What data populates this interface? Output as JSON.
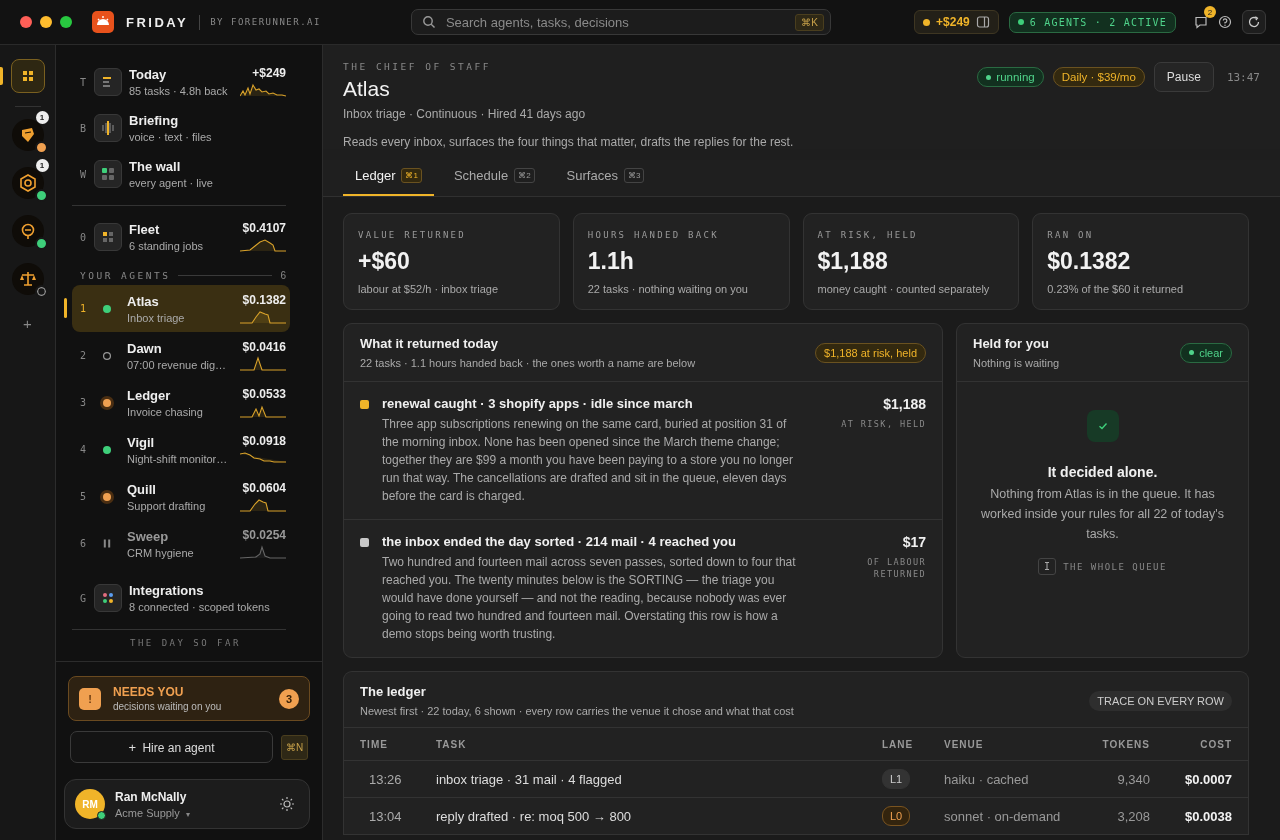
{
  "topbar": {
    "brand": "FRIDAY",
    "byline": "BY FORERUNNER.AI",
    "search": {
      "placeholder": "Search agents, tasks, decisions",
      "shortcut": "⌘K"
    },
    "earnings": "+$249",
    "agents_pill": "6 AGENTS · 2 ACTIVE",
    "messages_badge": "2"
  },
  "rail": {
    "home_selected": true,
    "agents": [
      {
        "badge": "1",
        "kind": "attention"
      },
      {
        "badge": "1",
        "kind": "running"
      },
      {
        "kind": "running"
      },
      {
        "kind": "idle"
      }
    ],
    "add": "+"
  },
  "sidebar": {
    "nav": [
      {
        "key": "T",
        "title": "Today",
        "subtitle": "85 tasks · 4.8h back",
        "value": "+$249"
      },
      {
        "key": "B",
        "title": "Briefing",
        "subtitle": "voice · text · files"
      },
      {
        "key": "W",
        "title": "The wall",
        "subtitle": "every agent · live"
      }
    ],
    "fleet": {
      "key": "0",
      "title": "Fleet",
      "subtitle": "6 standing jobs",
      "value": "$0.4107"
    },
    "section_label": "YOUR AGENTS",
    "section_count": "6",
    "agents": [
      {
        "key": "1",
        "name": "Atlas",
        "role": "Inbox triage",
        "cost": "$0.1382",
        "kind": "running",
        "selected": true
      },
      {
        "key": "2",
        "name": "Dawn",
        "role": "07:00 revenue dig…",
        "cost": "$0.0416",
        "kind": "idle",
        "selected": false
      },
      {
        "key": "3",
        "name": "Ledger",
        "role": "Invoice chasing",
        "cost": "$0.0533",
        "kind": "attention",
        "selected": false
      },
      {
        "key": "4",
        "name": "Vigil",
        "role": "Night-shift monitor…",
        "cost": "$0.0918",
        "kind": "running",
        "selected": false
      },
      {
        "key": "5",
        "name": "Quill",
        "role": "Support drafting",
        "cost": "$0.0604",
        "kind": "attention",
        "selected": false
      },
      {
        "key": "6",
        "name": "Sweep",
        "role": "CRM hygiene",
        "cost": "$0.0254",
        "kind": "paused",
        "selected": false
      }
    ],
    "integrations": {
      "key": "G",
      "title": "Integrations",
      "subtitle": "8 connected · scoped tokens"
    },
    "footer_label": "THE DAY SO FAR",
    "needs_you": {
      "icon": "!",
      "title": "NEEDS YOU",
      "subtitle": "decisions waiting on you",
      "count": "3"
    },
    "hire": {
      "icon": "+",
      "label": "Hire an agent",
      "shortcut": "⌘N"
    },
    "user": {
      "initials": "RM",
      "name": "Ran McNally",
      "org": "Acme Supply",
      "caret": "▾",
      "online": true
    }
  },
  "agent": {
    "eyebrow": "THE CHIEF OF STAFF",
    "name": "Atlas",
    "meta": "Inbox triage · Continuous · Hired 41 days ago",
    "description": "Reads every inbox, surfaces the four things that matter, drafts the replies for the rest.",
    "status": "running",
    "budget": "Daily · $39/mo",
    "action": "Pause",
    "time": "13:47"
  },
  "tabs": [
    {
      "label": "Ledger",
      "shortcut": "⌘1",
      "selected": true
    },
    {
      "label": "Schedule",
      "shortcut": "⌘2",
      "selected": false
    },
    {
      "label": "Surfaces",
      "shortcut": "⌘3",
      "selected": false
    }
  ],
  "stats": [
    {
      "label": "VALUE RETURNED",
      "value": "+$60",
      "note": "labour at $52/h · inbox triage"
    },
    {
      "label": "HOURS HANDED BACK",
      "value": "1.1h",
      "note": "22 tasks · nothing waiting on you"
    },
    {
      "label": "AT RISK, HELD",
      "value": "$1,188",
      "note": "money caught · counted separately"
    },
    {
      "label": "RAN ON",
      "value": "$0.1382",
      "note": "0.23% of the $60 it returned"
    }
  ],
  "returned": {
    "title": "What it returned today",
    "subtitle": "22 tasks · 1.1 hours handed back · the ones worth a name are below",
    "badge": "$1,188 at risk, held",
    "items": [
      {
        "title": "renewal caught · 3 shopify apps · idle since march",
        "body": "Three app subscriptions renewing on the same card, buried at position 31 of the morning inbox. None has been opened since the March theme change; together they are $99 a month you have been paying to a store you no longer run that way. The cancellations are drafted and sit in the queue, eleven days before the card is charged.",
        "amount": "$1,188",
        "amount_label": "AT RISK, HELD",
        "color": "#f0b429"
      },
      {
        "title": "the inbox ended the day sorted · 214 mail · 4 reached you",
        "body": "Two hundred and fourteen mail across seven passes, sorted down to four that reached you. The twenty minutes below is the SORTING — the triage you would have done yourself — and not the reading, because nobody was ever going to read two hundred and fourteen mail. Overstating this row is how a demo stops being worth trusting.",
        "amount": "$17",
        "amount_label": "OF LABOUR RETURNED",
        "color": "#c8c8c8"
      }
    ]
  },
  "held": {
    "title": "Held for you",
    "subtitle": "Nothing is waiting",
    "status": "clear",
    "headline": "It decided alone.",
    "body": "Nothing from Atlas is in the queue. It has worked inside your rules for all 22 of today's tasks.",
    "link_key": "I",
    "link_label": "THE WHOLE QUEUE"
  },
  "ledger": {
    "title": "The ledger",
    "subtitle": "Newest first · 22 today, 6 shown · every row carries the venue it chose and what that cost",
    "action": "TRACE ON EVERY ROW",
    "columns": [
      "TIME",
      "TASK",
      "LANE",
      "VENUE",
      "TOKENS",
      "COST"
    ],
    "rows": [
      {
        "time": "13:26",
        "task": "inbox triage · 31 mail · 4 flagged",
        "lane": "L1",
        "kind": "cached",
        "venue": "haiku · cached",
        "tokens": "9,340",
        "cost": "$0.0007"
      },
      {
        "time": "13:04",
        "task": "reply drafted · re: moq 500 → 800",
        "lane": "L0",
        "kind": "premium",
        "venue": "sonnet · on-demand",
        "tokens": "3,208",
        "cost": "$0.0038"
      }
    ]
  }
}
